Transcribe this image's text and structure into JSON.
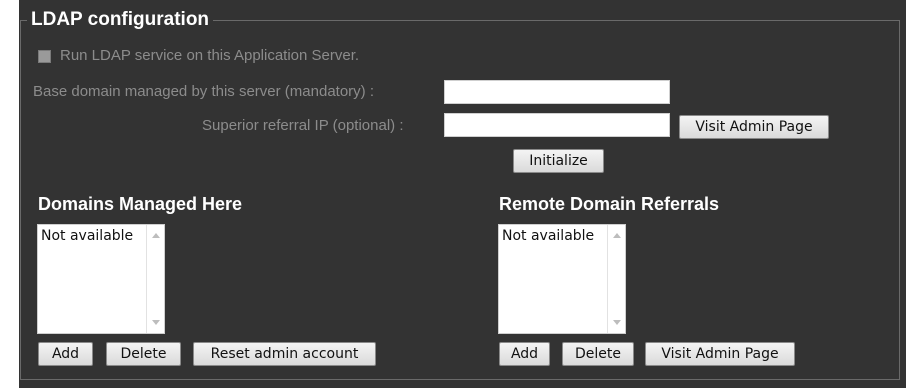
{
  "ldap": {
    "legend": "LDAP configuration",
    "run_service_label": "Run LDAP service on this Application Server.",
    "run_service_checked": true,
    "base_domain_label": "Base domain managed by this server (mandatory) :",
    "base_domain_value": "",
    "superior_referral_label": "Superior referral IP (optional) :",
    "superior_referral_value": "",
    "visit_admin_label": "Visit Admin Page",
    "initialize_label": "Initialize"
  },
  "domains_managed": {
    "heading": "Domains Managed Here",
    "items": [
      "Not available"
    ],
    "add_label": "Add",
    "delete_label": "Delete",
    "reset_label": "Reset admin account"
  },
  "remote_referrals": {
    "heading": "Remote Domain Referrals",
    "items": [
      "Not available"
    ],
    "add_label": "Add",
    "delete_label": "Delete",
    "visit_admin_label": "Visit Admin Page"
  }
}
